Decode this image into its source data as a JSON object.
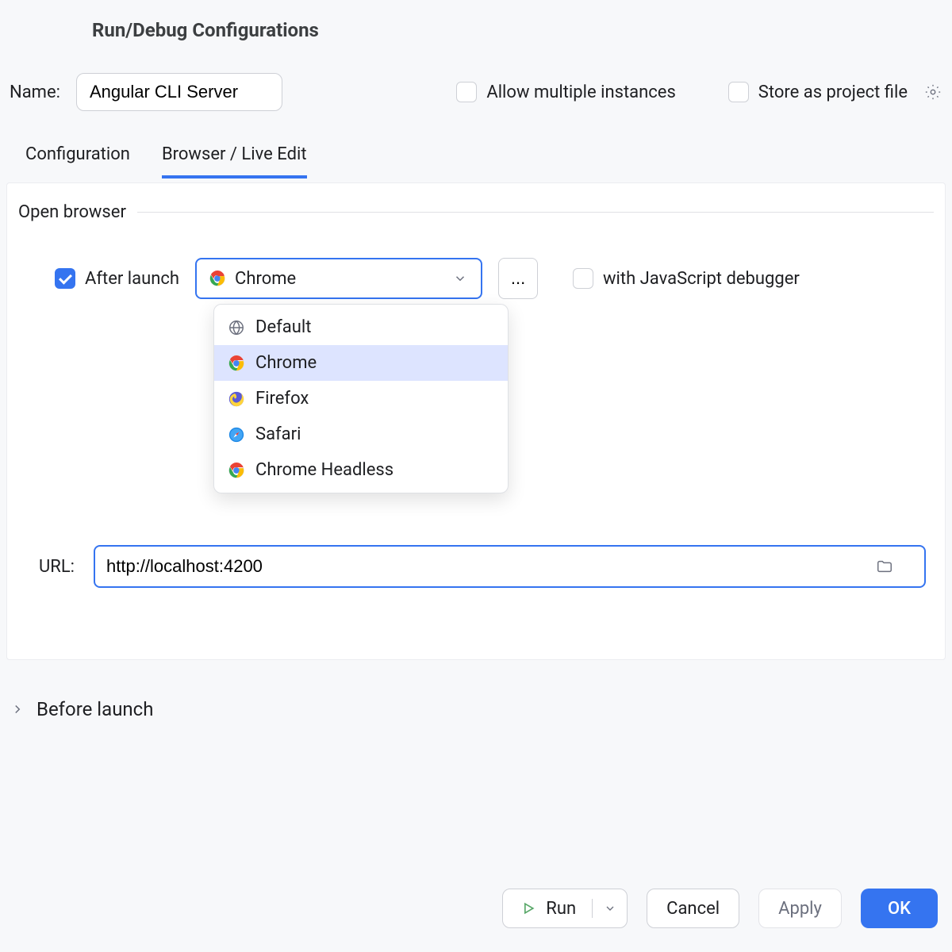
{
  "dialog": {
    "title": "Run/Debug Configurations"
  },
  "name": {
    "label": "Name:",
    "value": "Angular CLI Server"
  },
  "options": {
    "allow_multiple": "Allow multiple instances",
    "store_as_project": "Store as project file"
  },
  "tabs": {
    "configuration": "Configuration",
    "browser": "Browser / Live Edit"
  },
  "section": {
    "open_browser": "Open browser",
    "after_launch": "After launch",
    "with_js_debugger": "with JavaScript debugger",
    "url_label": "URL:",
    "url_value": "http://localhost:4200"
  },
  "browser_select": {
    "selected": "Chrome",
    "options": [
      "Default",
      "Chrome",
      "Firefox",
      "Safari",
      "Chrome Headless"
    ]
  },
  "before_launch": "Before launch",
  "buttons": {
    "run": "Run",
    "cancel": "Cancel",
    "apply": "Apply",
    "ok": "OK",
    "ellipsis": "..."
  }
}
